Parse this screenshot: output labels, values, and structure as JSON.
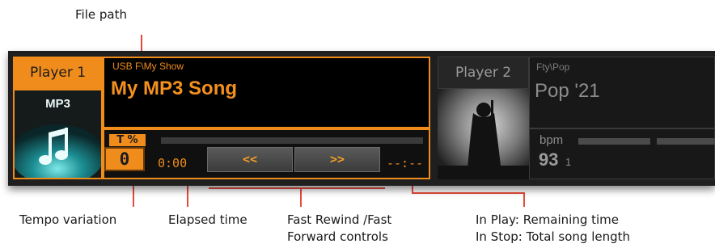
{
  "callouts": {
    "file_path": "File path",
    "tempo_variation": "Tempo variation",
    "elapsed_time": "Elapsed time",
    "fast_controls_line1": "Fast Rewind /Fast",
    "fast_controls_line2": "Forward controls",
    "remaining_line1": "In Play: Remaining time",
    "remaining_line2": "In Stop: Total song length"
  },
  "player1": {
    "tab_label": "Player 1",
    "artwork_label": "MP3",
    "file_path": "USB F\\My Show",
    "song_title": "My MP3 Song",
    "tempo_label": "T %",
    "tempo_value": "0",
    "elapsed": "0:00",
    "rewind_label": "<<",
    "forward_label": ">>",
    "remaining": "--:--"
  },
  "player2": {
    "tab_label": "Player 2",
    "file_path": "Fty\\Pop",
    "song_title": "Pop '21",
    "bpm_label": "bpm",
    "bpm_value": "93",
    "bpm_extra": "1"
  },
  "colors": {
    "accent": "#f08c1c",
    "callout_line": "#e74a3b"
  }
}
